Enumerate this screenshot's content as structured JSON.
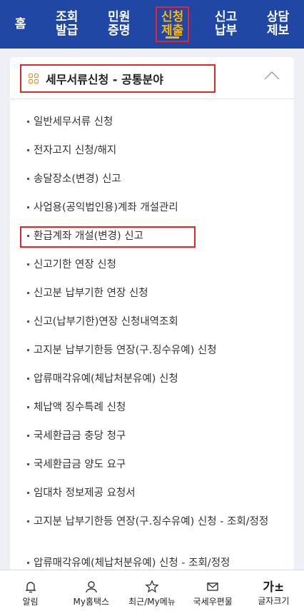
{
  "topnav": {
    "tabs": [
      {
        "line1": "홈",
        "line2": ""
      },
      {
        "line1": "조회",
        "line2": "발급"
      },
      {
        "line1": "민원",
        "line2": "증명"
      },
      {
        "line1": "신청",
        "line2": "제출"
      },
      {
        "line1": "신고",
        "line2": "납부"
      },
      {
        "line1": "상담",
        "line2": "제보"
      }
    ],
    "active_index": 3
  },
  "panel": {
    "title": "세무서류신청 - 공통분야",
    "items": [
      "일반세무서류 신청",
      "전자고지 신청/해지",
      "송달장소(변경) 신고",
      "사업용(공익법인용)계좌 개설관리",
      "환급계좌 개설(변경) 신고",
      "신고기한 연장 신청",
      "신고분 납부기한 연장 신청",
      "신고(납부기한)연장 신청내역조회",
      "고지분 납부기한등 연장(구.징수유예) 신청",
      "압류매각유예(체납처분유예) 신청",
      "체납액 징수특례 신청",
      "국세환급금 충당 청구",
      "국세환급금 양도 요구",
      "임대차 정보제공 요청서",
      "고지분 납부기한등 연장(구.징수유예) 신청 - 조회/정정",
      "압류매각유예(체납처분유예) 신청 - 조회/정정"
    ],
    "highlighted_index": 4
  },
  "bottombar": {
    "items": [
      {
        "label": "알림",
        "icon": "bell-icon"
      },
      {
        "label": "My홈택스",
        "icon": "person-icon"
      },
      {
        "label": "최근/My메뉴",
        "icon": "star-icon"
      },
      {
        "label": "국세우편물",
        "icon": "mail-icon"
      },
      {
        "label": "글자크기",
        "icon": "font-size-icon",
        "glyph": "가±"
      }
    ]
  },
  "colors": {
    "nav_bg": "#1f47a3",
    "active": "#ffb400",
    "highlight": "#e8242a",
    "accent_icon": "#f08a24"
  }
}
